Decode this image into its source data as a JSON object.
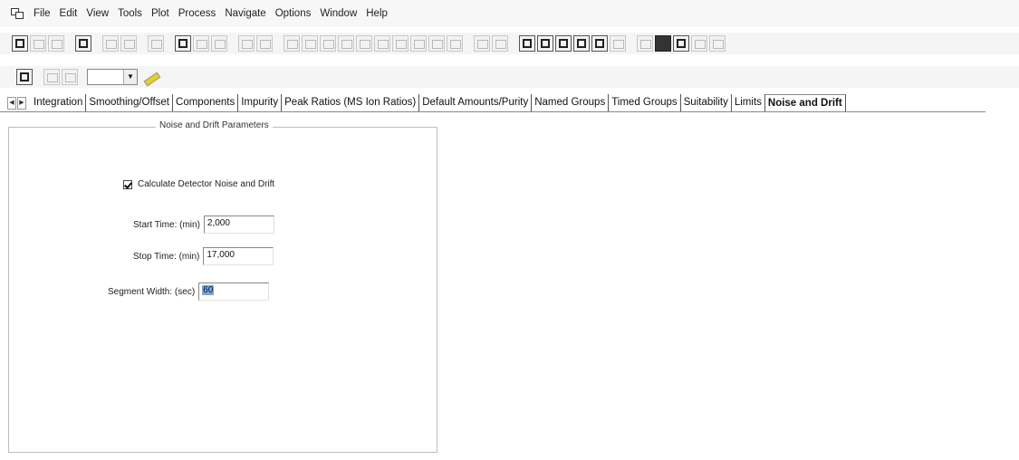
{
  "menubar": {
    "items": [
      "File",
      "Edit",
      "View",
      "Tools",
      "Plot",
      "Process",
      "Navigate",
      "Options",
      "Window",
      "Help"
    ]
  },
  "tabs": {
    "items": [
      "Integration",
      "Smoothing/Offset",
      "Components",
      "Impurity",
      "Peak Ratios (MS Ion Ratios)",
      "Default Amounts/Purity",
      "Named Groups",
      "Timed Groups",
      "Suitability",
      "Limits",
      "Noise and Drift"
    ],
    "active": "Noise and Drift"
  },
  "panel": {
    "title": "Noise and Drift Parameters",
    "checkbox_label": "Calculate Detector Noise and Drift",
    "checkbox_checked": true,
    "start_label": "Start Time: (min)",
    "start_value": "2,000",
    "stop_label": "Stop Time: (min)",
    "stop_value": "17,000",
    "segment_label": "Segment Width: (sec)",
    "segment_value": "60"
  }
}
